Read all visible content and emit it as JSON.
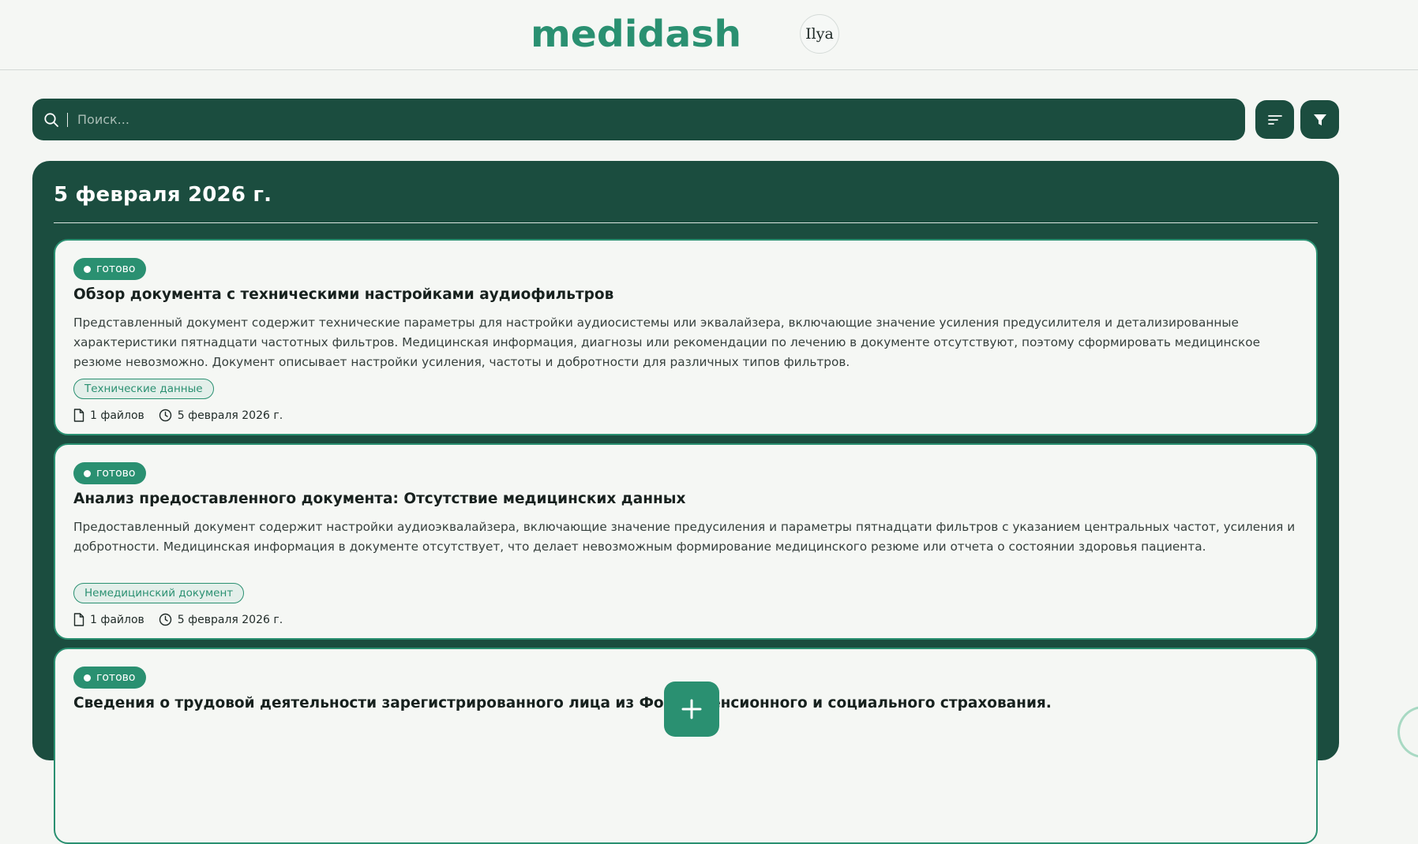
{
  "header": {
    "logo": "medidash",
    "user_name": "Ilya"
  },
  "search": {
    "placeholder": "Поиск...",
    "value": "",
    "icon": "search-icon"
  },
  "toolbar": {
    "sort_icon": "sort-icon",
    "filter_icon": "filter-icon"
  },
  "feed": {
    "date_heading": "5 февраля 2026 г.",
    "cards": [
      {
        "status": "готово",
        "title": "Обзор документа с техническими настройками аудиофильтров",
        "description": "Представленный документ содержит технические параметры для настройки аудиосистемы или эквалайзера, включающие значение усиления предусилителя и детализированные характеристики пятнадцати частотных фильтров. Медицинская информация, диагнозы или рекомендации по лечению в документе отсутствуют, поэтому сформировать медицинское резюме невозможно. Документ описывает настройки усиления, частоты и добротности для различных типов фильтров.",
        "tag": "Технические данные",
        "files": "1 файлов",
        "date": "5 февраля 2026 г."
      },
      {
        "status": "готово",
        "title": "Анализ предоставленного документа: Отсутствие медицинских данных",
        "description": "Предоставленный документ содержит настройки аудиоэквалайзера, включающие значение предусиления и параметры пятнадцати фильтров с указанием центральных частот, усиления и добротности. Медицинская информация в документе отсутствует, что делает невозможным формирование медицинского резюме или отчета о состоянии здоровья пациента.",
        "tag": "Немедицинский документ",
        "files": "1 файлов",
        "date": "5 февраля 2026 г."
      },
      {
        "status": "готово",
        "title": "Сведения о трудовой деятельности зарегистрированного лица из Фонда пенсионного и социального страхования.",
        "description": "",
        "tag": "",
        "files": "",
        "date": ""
      }
    ]
  },
  "fab": {
    "icon": "plus-icon"
  },
  "colors": {
    "brand": "#2a9071",
    "dark": "#1b4d3f",
    "background": "#f4f6f3"
  }
}
